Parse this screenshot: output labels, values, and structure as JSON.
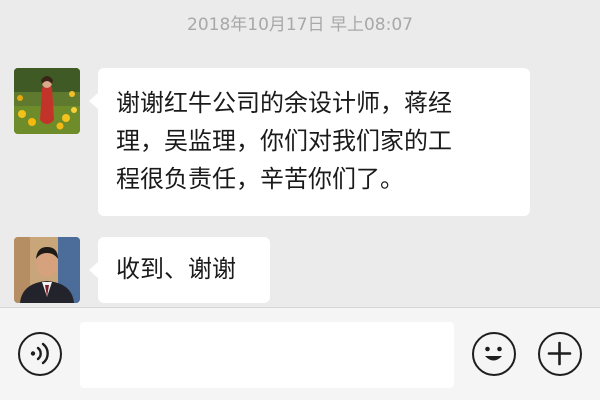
{
  "chat": {
    "timestamp": "2018年10月17日 早上08:07",
    "messages": [
      {
        "sender_avatar": "flowers-photo",
        "lines": [
          "谢谢红牛公司的余设计师，蒋经",
          "理，吴监理，你们对我们家的工",
          "程很负责任，辛苦你们了。"
        ]
      },
      {
        "sender_avatar": "man-in-suit-photo",
        "lines": [
          "收到、谢谢"
        ]
      }
    ]
  },
  "input_bar": {
    "voice_icon": "voice-wave-icon",
    "text_value": "",
    "emoji_icon": "smiley-icon",
    "more_icon": "plus-icon"
  },
  "colors": {
    "background": "#ebebeb",
    "bubble": "#ffffff",
    "timestamp_text": "#a8a8a8",
    "icon_stroke": "#1e1e1e"
  }
}
